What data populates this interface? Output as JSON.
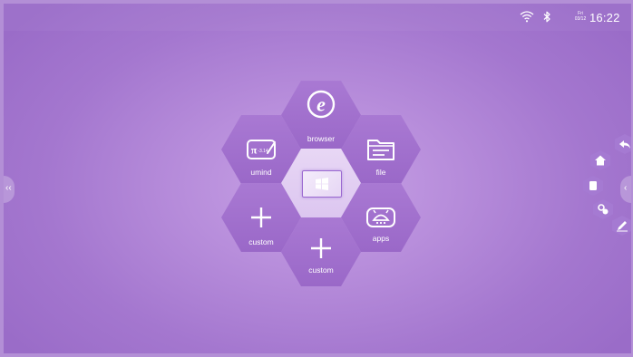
{
  "status_bar": {
    "date_day": "Fri",
    "date_md": "03/12",
    "time": "16:22",
    "icons": [
      "wifi-icon",
      "bluetooth-icon"
    ]
  },
  "launcher": {
    "tiles": [
      {
        "id": "browser",
        "label": "browser",
        "icon": "browser-e-icon"
      },
      {
        "id": "file",
        "label": "file",
        "icon": "folder-icon"
      },
      {
        "id": "umind",
        "label": "umind",
        "icon": "whiteboard-pi-icon"
      },
      {
        "id": "windows",
        "label": "",
        "icon": "windows-icon"
      },
      {
        "id": "apps",
        "label": "apps",
        "icon": "android-icon"
      },
      {
        "id": "custom_left",
        "label": "custom",
        "icon": "plus-icon"
      },
      {
        "id": "custom_bottom",
        "label": "custom",
        "icon": "plus-icon"
      }
    ],
    "umind_icon_text": "π",
    "umind_icon_subtext": "-3.14",
    "browser_icon_text": "e"
  },
  "side_tabs": {
    "left": "‹‹",
    "right": "‹"
  },
  "floating_menu": [
    "back-arrow-icon",
    "home-icon",
    "window-icon",
    "tools-icon",
    "pen-icon"
  ],
  "colors": {
    "background": "#b78ddb",
    "tile_purple": "#a979d3",
    "tile_center": "#e8d7f5",
    "accent_outline": "#9a68d0"
  }
}
